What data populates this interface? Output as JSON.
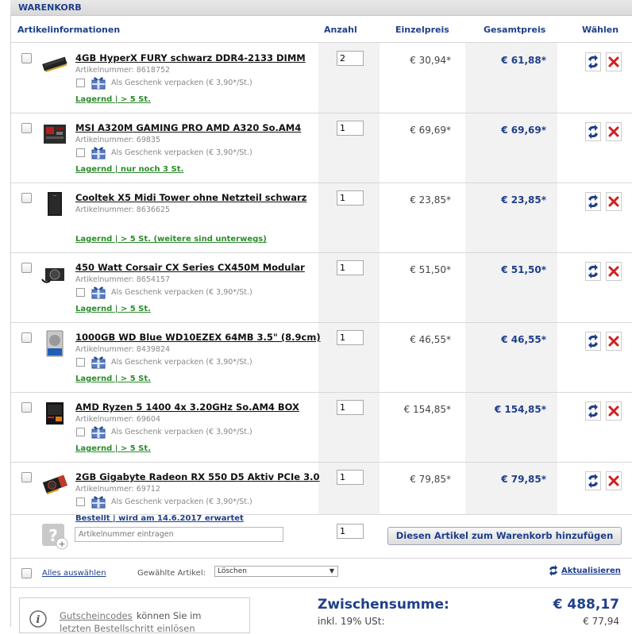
{
  "section_title": "WARENKORB",
  "columns": {
    "info": "Artikelinformationen",
    "qty": "Anzahl",
    "unit_price": "Einzelpreis",
    "total_price": "Gesamtpreis",
    "choose": "Wählen"
  },
  "items": [
    {
      "name": "4GB HyperX FURY schwarz DDR4-2133 DIMM",
      "artno": "Artikelnummer: 8618752",
      "gift": "Als Geschenk verpacken (€ 3,90*/St.)",
      "stock": "Lagernd | > 5 St.",
      "qty": "2",
      "unit": "€ 30,94*",
      "total": "€ 61,88*",
      "image": "ram-icon"
    },
    {
      "name": "MSI A320M GAMING PRO AMD A320 So.AM4",
      "artno": "Artikelnummer: 69835",
      "gift": "Als Geschenk verpacken (€ 3,90*/St.)",
      "stock": "Lagernd | nur noch 3 St.",
      "qty": "1",
      "unit": "€ 69,69*",
      "total": "€ 69,69*",
      "image": "mainboard-icon"
    },
    {
      "name": "Cooltek X5 Midi Tower ohne Netzteil schwarz",
      "artno": "Artikelnummer: 8636625",
      "gift": "",
      "stock": "Lagernd | > 5 St. (weitere sind unterwegs)",
      "qty": "1",
      "unit": "€ 23,85*",
      "total": "€ 23,85*",
      "image": "tower-icon"
    },
    {
      "name": "450 Watt Corsair CX Series CX450M Modular",
      "artno": "Artikelnummer: 8654157",
      "gift": "Als Geschenk verpacken (€ 3,90*/St.)",
      "stock": "Lagernd | > 5 St.",
      "qty": "1",
      "unit": "€ 51,50*",
      "total": "€ 51,50*",
      "image": "psu-icon"
    },
    {
      "name": "1000GB WD Blue WD10EZEX 64MB 3.5\" (8.9cm)",
      "artno": "Artikelnummer: 8439824",
      "gift": "Als Geschenk verpacken (€ 3,90*/St.)",
      "stock": "Lagernd | > 5 St.",
      "qty": "1",
      "unit": "€ 46,55*",
      "total": "€ 46,55*",
      "image": "hdd-icon"
    },
    {
      "name": "AMD Ryzen 5 1400 4x 3.20GHz So.AM4 BOX",
      "artno": "Artikelnummer: 69604",
      "gift": "Als Geschenk verpacken (€ 3,90*/St.)",
      "stock": "Lagernd | > 5 St.",
      "qty": "1",
      "unit": "€ 154,85*",
      "total": "€ 154,85*",
      "image": "cpu-box-icon"
    },
    {
      "name": "2GB Gigabyte Radeon RX 550 D5 Aktiv PCIe 3.0",
      "artno": "Artikelnummer: 69712",
      "gift": "Als Geschenk verpacken (€ 3,90*/St.)",
      "stock": "Bestellt | wird am 14.6.2017 erwartet",
      "qty": "1",
      "unit": "€ 79,85*",
      "total": "€ 79,85*",
      "image": "gpu-icon"
    }
  ],
  "colors": {
    "brand_blue": "#1f3f8a",
    "stock_green": "#2e8b2e",
    "ordered_blue": "#1f3f8a"
  },
  "add_row": {
    "placeholder": "Artikelnummer eintragen",
    "qty": "1",
    "button": "Diesen Artikel zum Warenkorb hinzufügen"
  },
  "footer": {
    "select_all": "Alles auswählen",
    "selected_label": "Gewählte Artikel:",
    "action_value": "Löschen",
    "refresh": "Aktualisieren"
  },
  "summary": {
    "subtotal_label": "Zwischensumme:",
    "subtotal_value": "€ 488,17",
    "vat_label": "inkl. 19% USt:",
    "vat_value": "€ 77,94"
  },
  "coupon": {
    "link": "Gutscheincodes",
    "text": "können Sie im",
    "text2": "letzten Bestellschritt einlösen"
  }
}
